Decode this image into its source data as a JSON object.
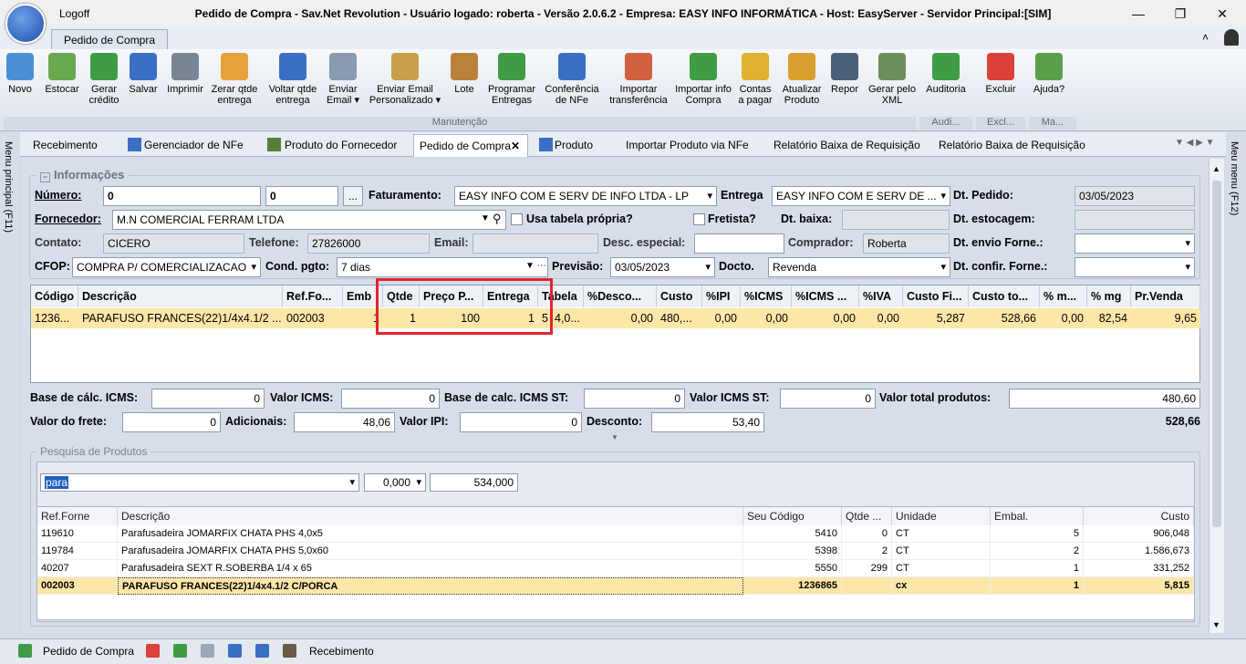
{
  "window": {
    "logoff": "Logoff",
    "title": "Pedido de Compra - Sav.Net Revolution - Usuário logado: roberta - Versão 2.0.6.2 - Empresa: EASY INFO INFORMÁTICA - Host: EasyServer - Servidor Principal:[SIM]",
    "ribbon_tab": "Pedido de Compra"
  },
  "ribbon": {
    "buttons": [
      {
        "label": "Novo",
        "icon": "new-doc-icon"
      },
      {
        "label": "Estocar",
        "icon": "stock-icon"
      },
      {
        "label": "Gerar crédito",
        "icon": "money-add-icon"
      },
      {
        "label": "Salvar",
        "icon": "save-icon"
      },
      {
        "label": "Imprimir",
        "icon": "print-icon"
      },
      {
        "label": "Zerar qtde entrega",
        "icon": "zero-icon"
      },
      {
        "label": "Voltar qtde entrega",
        "icon": "undo-icon"
      },
      {
        "label": "Enviar Email ▾",
        "icon": "email-icon"
      },
      {
        "label": "Enviar Email Personalizado ▾",
        "icon": "email-custom-icon"
      },
      {
        "label": "Lote",
        "icon": "boxes-icon"
      },
      {
        "label": "Programar Entregas",
        "icon": "schedule-icon"
      },
      {
        "label": "Conferência de NFe",
        "icon": "nfe-icon"
      },
      {
        "label": "Importar transferência",
        "icon": "transfer-icon"
      },
      {
        "label": "Importar info Compra",
        "icon": "import-icon"
      },
      {
        "label": "Contas a pagar",
        "icon": "coins-icon"
      },
      {
        "label": "Atualizar Produto",
        "icon": "update-icon"
      },
      {
        "label": "Repor",
        "icon": "shelf-icon"
      },
      {
        "label": "Gerar pelo XML",
        "icon": "xml-icon"
      },
      {
        "label": "Auditoria",
        "icon": "audit-icon"
      },
      {
        "label": "Excluir",
        "icon": "delete-icon"
      },
      {
        "label": "Ajuda?",
        "icon": "help-icon"
      }
    ],
    "groups": [
      "Manutenção",
      "Audi...",
      "Excl...",
      "Ma..."
    ]
  },
  "tabs": [
    "Recebimento",
    "Gerenciador de NFe",
    "Produto do Fornecedor",
    "Pedido de Compra",
    "Produto",
    "Importar Produto via NFe",
    "Relatório Baixa de Requisição",
    "Relatório Baixa de Requisição"
  ],
  "side": {
    "left": "Menu principal (F11)",
    "right": "Meu menu (F12)"
  },
  "info": {
    "title": "Informações",
    "numero_label": "Número:",
    "numero1": "0",
    "numero2": "0",
    "ellipsis": "...",
    "faturamento_label": "Faturamento:",
    "faturamento": "EASY INFO COM E SERV DE INFO LTDA - LP",
    "entrega_label": "Entrega",
    "entrega": "EASY INFO COM E SERV DE ...",
    "dt_pedido_label": "Dt. Pedido:",
    "dt_pedido": "03/05/2023",
    "fornecedor_label": "Fornecedor:",
    "fornecedor": "M.N COMERCIAL FERRAM LTDA",
    "usa_tabela_label": "Usa tabela própria?",
    "fretista_label": "Fretista?",
    "dt_baixa_label": "Dt. baixa:",
    "dt_estocagem_label": "Dt. estocagem:",
    "contato_label": "Contato:",
    "contato": "CICERO",
    "telefone_label": "Telefone:",
    "telefone": "27826000",
    "email_label": "Email:",
    "desc_especial_label": "Desc. especial:",
    "comprador_label": "Comprador:",
    "comprador": "Roberta",
    "dt_envio_label": "Dt. envio Forne.:",
    "cfop_label": "CFOP:",
    "cfop": "COMPRA P/ COMERCIALIZACAO",
    "cond_pgto_label": "Cond. pgto:",
    "cond_pgto": "7 dias",
    "previsao_label": "Previsão:",
    "previsao": "03/05/2023",
    "docto_label": "Docto.",
    "docto": "Revenda",
    "dt_confir_label": "Dt. confir. Forne.:"
  },
  "items": {
    "headers": [
      "Código",
      "Descrição",
      "Ref.Fo...",
      "Emb",
      "Qtde",
      "Preço P...",
      "Entrega",
      "Tabela",
      "%Desco...",
      "Custo",
      "%IPI",
      "%ICMS",
      "%ICMS ...",
      "%IVA",
      "Custo Fi...",
      "Custo to...",
      "% m...",
      "% mg",
      "Pr.Venda"
    ],
    "row": [
      "1236...",
      "PARAFUSO FRANCES(22)1/4x4.1/2 ...",
      "002003",
      "1",
      "1",
      "100",
      "1",
      "5",
      "4,0...",
      "0,00",
      "480,...",
      "0,00",
      "0,00",
      "0,00",
      "0,00",
      "5,287",
      "528,66",
      "0,00",
      "82,54",
      "9,65"
    ]
  },
  "totals": {
    "base_icms_label": "Base de cálc.  ICMS:",
    "base_icms": "0",
    "valor_icms_label": "Valor ICMS:",
    "valor_icms": "0",
    "base_icms_st_label": "Base de calc.  ICMS ST:",
    "base_icms_st": "0",
    "valor_icms_st_label": "Valor ICMS ST:",
    "valor_icms_st": "0",
    "valor_total_label": "Valor total produtos:",
    "valor_total": "480,60",
    "frete_label": "Valor do frete:",
    "frete": "0",
    "adicionais_label": "Adicionais:",
    "adicionais": "48,06",
    "ipi_label": "Valor IPI:",
    "ipi": "0",
    "desconto_label": "Desconto:",
    "desconto": "53,40",
    "grand_total": "528,66"
  },
  "search": {
    "title": "Pesquisa de Produtos",
    "query": "para",
    "qty": "0,000",
    "price": "534,000",
    "headers": [
      "Ref.Forne",
      "Descrição",
      "Seu Código",
      "Qtde ...",
      "Unidade",
      "Embal.",
      "Custo"
    ],
    "rows": [
      [
        "119610",
        "Parafusadeira JOMARFIX CHATA PHS 4,0x5",
        "5410",
        "0",
        "CT",
        "5",
        "906,048"
      ],
      [
        "119784",
        "Parafusadeira JOMARFIX CHATA PHS 5,0x60",
        "5398",
        "2",
        "CT",
        "2",
        "1.586,673"
      ],
      [
        "40207",
        "Parafusadeira SEXT R.SOBERBA  1/4 x 65",
        "5550",
        "299",
        "CT",
        "1",
        "331,252"
      ],
      [
        "002003",
        "PARAFUSO FRANCES(22)1/4x4.1/2 C/PORCA",
        "1236865",
        "",
        "cx",
        "1",
        "5,815"
      ]
    ]
  },
  "status": {
    "label1": "Pedido de Compra",
    "label2": "Recebimento"
  },
  "colors": {
    "highlight": "#e0242c",
    "selected_row": "#fde7a8"
  }
}
